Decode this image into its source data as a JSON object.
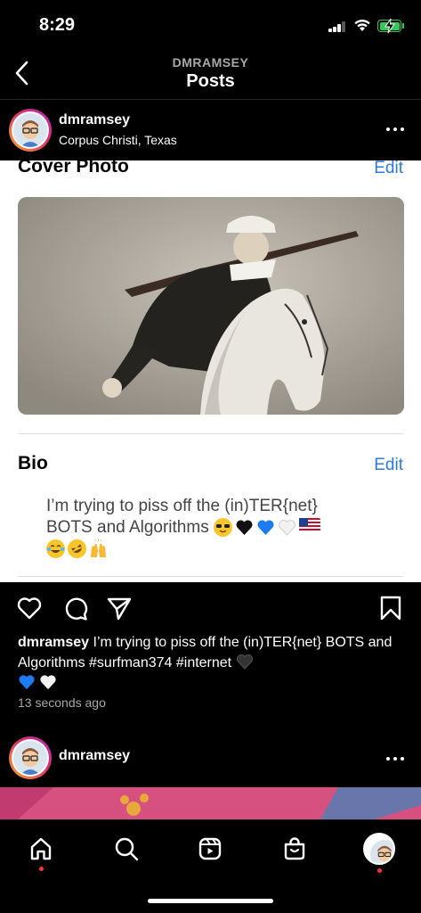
{
  "status_bar": {
    "time": "8:29"
  },
  "header": {
    "account": "DMRAMSEY",
    "title": "Posts"
  },
  "post": {
    "username": "dmramsey",
    "location": "Corpus Christi, Texas",
    "image": {
      "cover_title": "Cover Photo",
      "cover_edit": "Edit",
      "bio_title": "Bio",
      "bio_edit": "Edit",
      "bio_text": "I’m trying to piss off the (in)TER{net} BOTS and Algorithms"
    },
    "caption_user": "dmramsey",
    "caption_text": "I’m trying to piss off the (in)TER{net} BOTS and Algorithms #surfman374 #internet",
    "timestamp": "13 seconds ago"
  },
  "next_post": {
    "username": "dmramsey"
  },
  "tabs": [
    {
      "name": "home",
      "icon": "home-icon"
    },
    {
      "name": "search",
      "icon": "search-icon"
    },
    {
      "name": "reels",
      "icon": "reels-icon"
    },
    {
      "name": "shop",
      "icon": "shop-icon"
    },
    {
      "name": "profile",
      "icon": "profile-avatar"
    }
  ],
  "colors": {
    "accent_blue": "#2f7ad8",
    "notification_red": "#ff3040",
    "battery_green": "#36c75a"
  }
}
